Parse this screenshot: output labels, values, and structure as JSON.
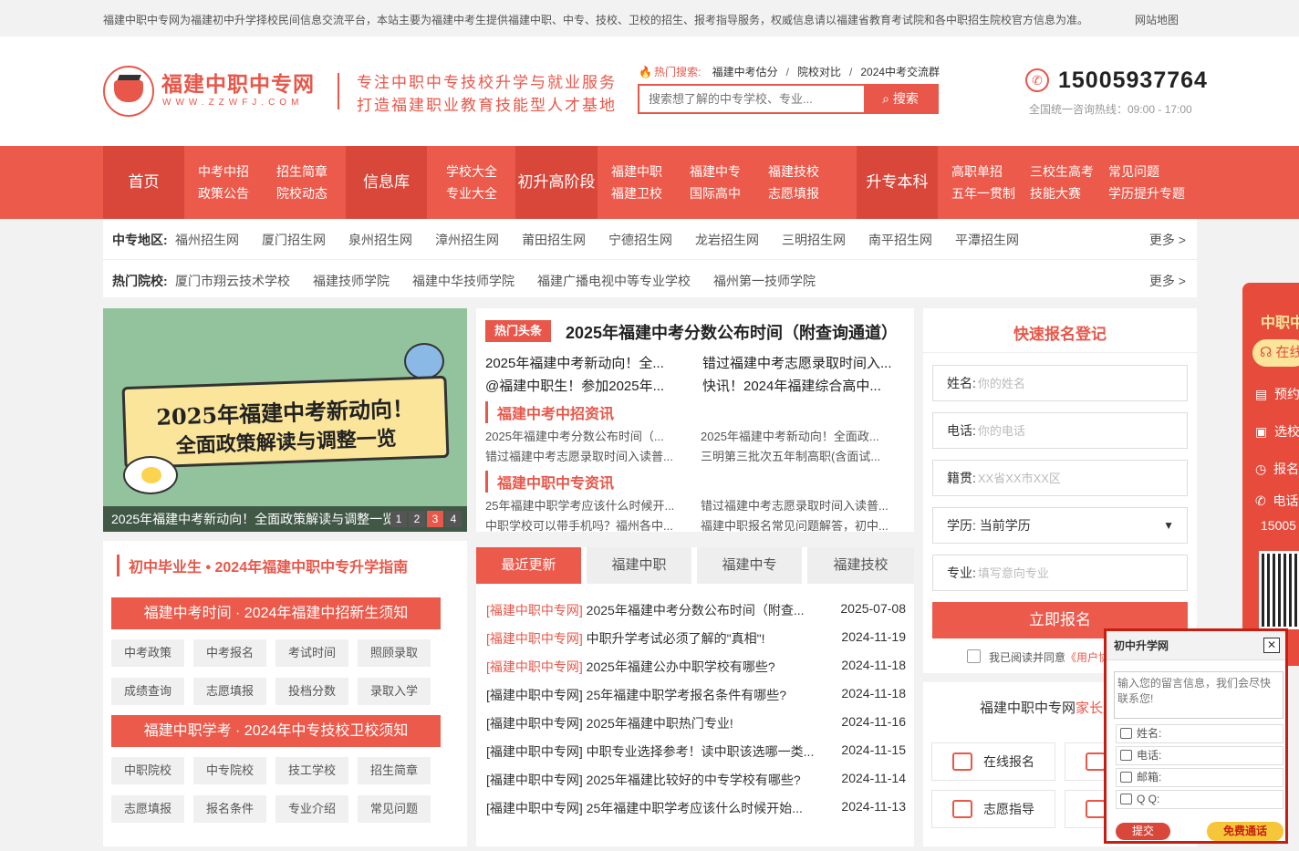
{
  "topbar": {
    "notice": "福建中职中专网为福建初中升学择校民间信息交流平台，本站主要为福建中考生提供福建中职、中专、技校、卫校的招生、报考指导服务，权威信息请以福建省教育考试院和各中职招生院校官方信息为准。",
    "sitemap": "网站地图"
  },
  "header": {
    "logo_title": "福建中职中专网",
    "logo_domain": "WWW.ZZWFJ.COM",
    "slogan_1": "专注中职中专技校升学与就业服务",
    "slogan_2": "打造福建职业教育技能型人才基地",
    "hot_label": "热门搜索:",
    "hot_items": [
      "福建中考估分",
      "院校对比",
      "2024中考交流群"
    ],
    "search_placeholder": "搜索想了解的中专学校、专业...",
    "search_button": "搜索",
    "phone": "15005937764",
    "hours": "全国统一咨询热线：09:00 - 17:00"
  },
  "nav": {
    "home": "首页",
    "g1": [
      "中考中招",
      "招生简章",
      "政策公告",
      "院校动态"
    ],
    "info": "信息库",
    "g2": [
      "学校大全",
      "专业大全"
    ],
    "upgrade": "初升高阶段",
    "g3": [
      "福建中职",
      "福建中专",
      "福建技校",
      "福建卫校",
      "国际高中",
      "志愿填报"
    ],
    "college": "升专本科",
    "g4": [
      "高职单招",
      "三校生高考",
      "常见问题",
      "五年一贯制",
      "技能大赛",
      "学历提升专题"
    ]
  },
  "regions": {
    "label": "中专地区:",
    "items": [
      "福州招生网",
      "厦门招生网",
      "泉州招生网",
      "漳州招生网",
      "莆田招生网",
      "宁德招生网",
      "龙岩招生网",
      "三明招生网",
      "南平招生网",
      "平潭招生网"
    ],
    "more": "更多 >"
  },
  "schools": {
    "label": "热门院校:",
    "items": [
      "厦门市翔云技术学校",
      "福建技师学院",
      "福建中华技师学院",
      "福建广播电视中等专业学校",
      "福州第一技师学院"
    ],
    "more": "更多 >"
  },
  "banner": {
    "art_line1": "2025年福建中考新动向！",
    "art_line2": "全面政策解读与调整一览",
    "caption": "2025年福建中考新动向！全面政策解读与调整一览",
    "dots": [
      "1",
      "2",
      "3",
      "4"
    ]
  },
  "guide": {
    "title": "初中毕业生 • 2024年福建中职中专升学指南",
    "bar1": "福建中考时间 · 2024年福建中招新生须知",
    "tags1": [
      "中考政策",
      "中考报名",
      "考试时间",
      "照顾录取",
      "成绩查询",
      "志愿填报",
      "投档分数",
      "录取入学"
    ],
    "bar2": "福建中职学考 · 2024年中专技校卫校须知",
    "tags2": [
      "中职院校",
      "中专院校",
      "技工学校",
      "招生简章",
      "志愿填报",
      "报名条件",
      "专业介绍",
      "常见问题"
    ]
  },
  "news": {
    "badge": "热门头条",
    "headline": "2025年福建中考分数公布时间（附查询通道）",
    "top": [
      "2025年福建中考新动向！全...",
      "错过福建中考志愿录取时间入...",
      "@福建中职生！参加2025年...",
      "快讯！2024年福建综合高中..."
    ],
    "sec1": "福建中考中招资讯",
    "sec1_items": [
      "2025年福建中考分数公布时间（...",
      "2025年福建中考新动向！全面政...",
      "错过福建中考志愿录取时间入读普...",
      "三明第三批次五年制高职(含面试..."
    ],
    "sec2": "福建中职中专资讯",
    "sec2_items": [
      "25年福建中职学考应该什么时候开...",
      "错过福建中考志愿录取时间入读普...",
      "中职学校可以带手机吗？福州各中...",
      "福建中职报名常见问题解答，初中..."
    ]
  },
  "latest": {
    "tabs": [
      "最近更新",
      "福建中职",
      "福建中专",
      "福建技校"
    ],
    "rows": [
      {
        "prefix": "[福建中职中专网]",
        "title": "2025年福建中考分数公布时间（附查...",
        "date": "2025-07-08"
      },
      {
        "prefix": "[福建中职中专网]",
        "title": "中职升学考试必须了解的\"真相\"!",
        "date": "2024-11-19"
      },
      {
        "prefix": "[福建中职中专网]",
        "title": "2025年福建公办中职学校有哪些?",
        "date": "2024-11-18"
      },
      {
        "prefix": "[福建中职中专网]",
        "title": "25年福建中职学考报名条件有哪些?",
        "date": "2024-11-18"
      },
      {
        "prefix": "[福建中职中专网]",
        "title": "2025年福建中职热门专业!",
        "date": "2024-11-16"
      },
      {
        "prefix": "[福建中职中专网]",
        "title": "中职专业选择参考！读中职该选哪一类...",
        "date": "2024-11-15"
      },
      {
        "prefix": "[福建中职中专网]",
        "title": "2025年福建比较好的中专学校有哪些?",
        "date": "2024-11-14"
      },
      {
        "prefix": "[福建中职中专网]",
        "title": "25年福建中职学考应该什么时候开始...",
        "date": "2024-11-13"
      }
    ]
  },
  "register": {
    "title": "快速报名登记",
    "name_label": "姓名:",
    "name_ph": "你的姓名",
    "phone_label": "电话:",
    "phone_ph": "你的电话",
    "origin_label": "籍贯:",
    "origin_ph": "XX省XX市XX区",
    "edu_label": "学历:",
    "edu_value": "当前学历",
    "major_label": "专业:",
    "major_ph": "填写意向专业",
    "submit": "立即报名",
    "agree": "我已阅读并同意",
    "agree_link": "《用户协议》"
  },
  "family": {
    "title": "福建中职中专网",
    "title_red": "家长服务",
    "services": [
      "在线报名",
      "志愿指导"
    ]
  },
  "float": {
    "title": "中职中专",
    "pill": "在线咨询",
    "items": [
      "预约",
      "选校",
      "报名",
      "电话"
    ],
    "number": "15005"
  },
  "chat": {
    "title": "初中升学网",
    "close": "✕",
    "message_ph": "输入您的留言信息，我们会尽快联系您!",
    "name": "姓名:",
    "phone": "电话:",
    "email": "邮箱:",
    "qq": "Q  Q:",
    "send": "提交",
    "call": "免费通话"
  }
}
